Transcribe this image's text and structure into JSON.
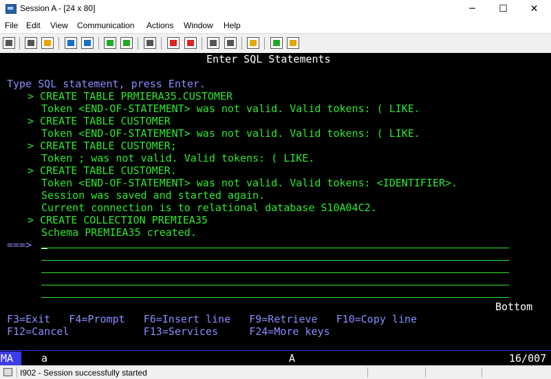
{
  "window": {
    "title": "Session A - [24 x 80]",
    "minimize": "─",
    "maximize": "☐",
    "close": "✕"
  },
  "menu": [
    "File",
    "Edit",
    "View",
    "Communication",
    "Actions",
    "Window",
    "Help"
  ],
  "toolbar_icons": [
    "print-screen-icon",
    "copy-icon",
    "paste-icon",
    "send-icon",
    "receive-icon",
    "display-icon",
    "keypad-icon",
    "macro-icon",
    "record-macro-icon",
    "stop-macro-icon",
    "play-macro-icon",
    "quick-macro-icon",
    "clipboard-icon",
    "globe-icon",
    "support-icon"
  ],
  "screen": {
    "header": "Enter SQL Statements",
    "prompt": "Type SQL statement, press Enter.",
    "lines": [
      {
        "text": "> CREATE TABLE PRMIERA35.CUSTOMER",
        "kind": "stmt"
      },
      {
        "text": "Token <END-OF-STATEMENT> was not valid. Valid tokens: ( LIKE.",
        "kind": "msg"
      },
      {
        "text": "> CREATE TABLE CUSTOMER",
        "kind": "stmt"
      },
      {
        "text": "Token <END-OF-STATEMENT> was not valid. Valid tokens: ( LIKE.",
        "kind": "msg"
      },
      {
        "text": "> CREATE TABLE CUSTOMER;",
        "kind": "stmt"
      },
      {
        "text": "Token ; was not valid. Valid tokens: ( LIKE.",
        "kind": "msg"
      },
      {
        "text": "> CREATE TABLE CUSTOMER.",
        "kind": "stmt"
      },
      {
        "text": "Token <END-OF-STATEMENT> was not valid. Valid tokens: <IDENTIFIER>.",
        "kind": "msg"
      },
      {
        "text": "Session was saved and started again.",
        "kind": "msg"
      },
      {
        "text": "Current connection is to relational database S10A04C2.",
        "kind": "msg"
      },
      {
        "text": "> CREATE COLLECTION PREMIEA35",
        "kind": "stmt"
      },
      {
        "text": "Schema PREMIEA35 created.",
        "kind": "msg"
      }
    ],
    "input_arrow": "===>",
    "input_value": "",
    "bottom": "Bottom",
    "fkeys_row1": "F3=Exit   F4=Prompt   F6=Insert line   F9=Retrieve   F10=Copy line",
    "fkeys_row2": "F12=Cancel            F13=Services     F24=More keys"
  },
  "oia": {
    "ma": "MA",
    "session": "a",
    "mode": "A",
    "position": "16/007"
  },
  "statusbar": {
    "message": "I902 - Session successfully started"
  }
}
